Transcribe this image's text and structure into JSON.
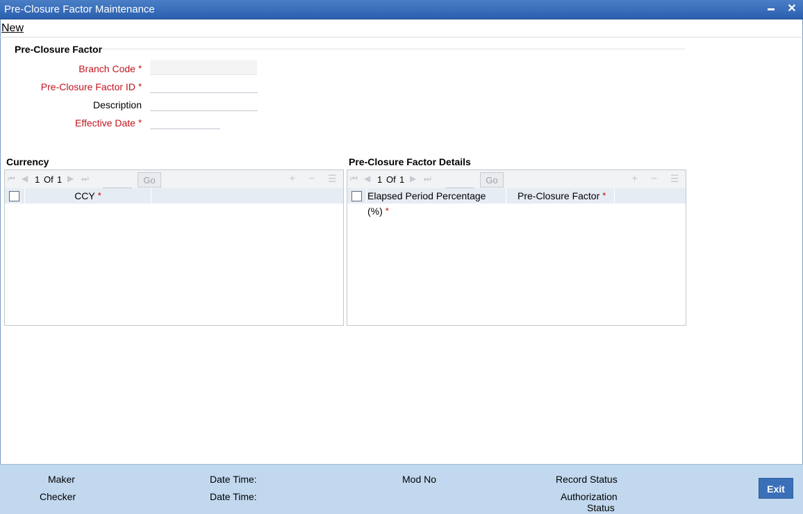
{
  "window": {
    "title": "Pre-Closure Factor Maintenance",
    "minimize": "▬",
    "close": "✕"
  },
  "menu": {
    "new_label": "New"
  },
  "form": {
    "section_title": "Pre-Closure Factor",
    "branch_code_label": "Branch Code",
    "factor_id_label": "Pre-Closure Factor ID",
    "description_label": "Description",
    "effective_date_label": "Effective Date",
    "required_mark": "*",
    "branch_code_value": "",
    "factor_id_value": "",
    "description_value": "",
    "effective_date_value": ""
  },
  "currency_grid": {
    "title": "Currency",
    "page_current": "1",
    "page_of": "Of",
    "page_total": "1",
    "go_label": "Go",
    "columns": [
      "CCY"
    ],
    "rows": []
  },
  "details_grid": {
    "title": "Pre-Closure Factor Details",
    "page_current": "1",
    "page_of": "Of",
    "page_total": "1",
    "go_label": "Go",
    "columns": [
      "Elapsed Period Percentage (%)",
      "Pre-Closure Factor"
    ],
    "rows": []
  },
  "footer": {
    "maker_label": "Maker",
    "checker_label": "Checker",
    "date_time_label_1": "Date Time:",
    "date_time_label_2": "Date Time:",
    "mod_no_label": "Mod No",
    "record_status_label": "Record Status",
    "auth_status_label_1": "Authorization",
    "auth_status_label_2": "Status",
    "exit_label": "Exit"
  },
  "icons": {
    "first": "first-page-icon",
    "prev": "prev-page-icon",
    "next": "next-page-icon",
    "last": "last-page-icon",
    "add": "add-row-icon",
    "remove": "remove-row-icon",
    "list": "single-view-icon"
  }
}
